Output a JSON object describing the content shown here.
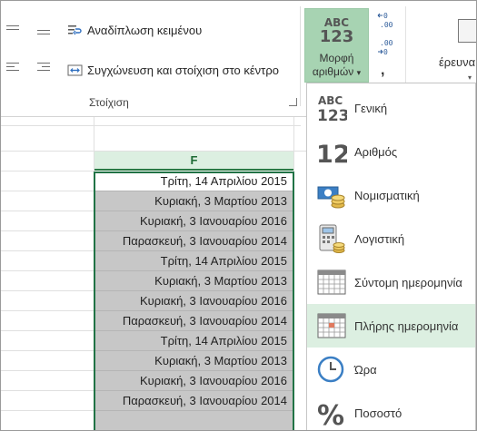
{
  "ribbon": {
    "wrap_text_label": "Αναδίπλωση κειμένου",
    "merge_center_label": "Συγχώνευση και στοίχιση στο κέντρο",
    "alignment_group_label": "Στοίχιση",
    "number_format": {
      "abc": "ABC",
      "num": "123",
      "label_line1": "Μορφή",
      "label_line2": "αριθμών",
      "caret": "▾"
    },
    "increase_decimal": "←0\n.00",
    "decrease_decimal": ".00\n→0",
    "comma_style": ",",
    "find_label": "έρευνα",
    "find_caret": "▾"
  },
  "sheet": {
    "column_header": "F",
    "cells": [
      "Τρίτη, 14 Απριλίου 2015",
      "Κυριακή, 3 Μαρτίου 2013",
      "Κυριακή, 3 Ιανουαρίου 2016",
      "Παρασκευή, 3 Ιανουαρίου 2014",
      "Τρίτη, 14 Απριλίου 2015",
      "Κυριακή, 3 Μαρτίου 2013",
      "Κυριακή, 3 Ιανουαρίου 2016",
      "Παρασκευή, 3 Ιανουαρίου 2014",
      "Τρίτη, 14 Απριλίου 2015",
      "Κυριακή, 3 Μαρτίου 2013",
      "Κυριακή, 3 Ιανουαρίου 2016",
      "Παρασκευή, 3 Ιανουαρίου 2014",
      ""
    ]
  },
  "dropdown": {
    "items": [
      {
        "label": "Γενική",
        "icon": "general-format-icon"
      },
      {
        "label": "Αριθμός",
        "icon": "number-format-icon"
      },
      {
        "label": "Νομισματική",
        "icon": "currency-format-icon"
      },
      {
        "label": "Λογιστική",
        "icon": "accounting-format-icon"
      },
      {
        "label": "Σύντομη ημερομηνία",
        "icon": "short-date-icon"
      },
      {
        "label": "Πλήρης ημερομηνία",
        "icon": "long-date-icon"
      },
      {
        "label": "Ώρα",
        "icon": "time-icon"
      },
      {
        "label": "Ποσοστό",
        "icon": "percent-icon"
      }
    ],
    "highlighted_index": 5,
    "general_icon_abc": "ABC",
    "general_icon_num": "123",
    "number_icon_text": "12",
    "percent_icon_text": "%"
  },
  "colors": {
    "accent_green": "#217346",
    "highlight": "#dcefe1",
    "selected_cells": "#c7c7c7"
  }
}
